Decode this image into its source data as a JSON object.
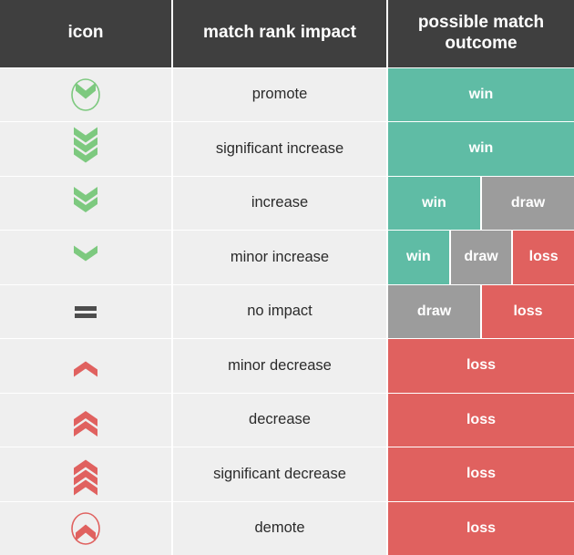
{
  "table": {
    "headers": {
      "icon": "icon",
      "impact": "match rank impact",
      "outcome": "possible match outcome"
    },
    "colors": {
      "header_bg": "#3f3f3f",
      "row_bg": "#efefef",
      "win": "#5fbca5",
      "draw": "#9c9c9c",
      "loss": "#e0615f",
      "up_icon": "#7dc97f",
      "down_icon": "#e0615f",
      "neutral_icon": "#4d4d4d",
      "text": "#2b2b2b",
      "header_text": "#ffffff"
    },
    "rows": [
      {
        "icon": "circled-chevron-up-icon",
        "impact": "promote",
        "outcomes": [
          {
            "label": "win",
            "type": "win",
            "weight": 3
          }
        ]
      },
      {
        "icon": "triple-chevron-up-icon",
        "impact": "significant increase",
        "outcomes": [
          {
            "label": "win",
            "type": "win",
            "weight": 3
          }
        ]
      },
      {
        "icon": "double-chevron-up-icon",
        "impact": "increase",
        "outcomes": [
          {
            "label": "win",
            "type": "win",
            "weight": 1.5
          },
          {
            "label": "draw",
            "type": "draw",
            "weight": 1.5
          }
        ]
      },
      {
        "icon": "single-chevron-up-icon",
        "impact": "minor increase",
        "outcomes": [
          {
            "label": "win",
            "type": "win",
            "weight": 1
          },
          {
            "label": "draw",
            "type": "draw",
            "weight": 1
          },
          {
            "label": "loss",
            "type": "loss",
            "weight": 1
          }
        ]
      },
      {
        "icon": "equals-icon",
        "impact": "no impact",
        "outcomes": [
          {
            "label": "draw",
            "type": "draw",
            "weight": 1.5
          },
          {
            "label": "loss",
            "type": "loss",
            "weight": 1.5
          }
        ]
      },
      {
        "icon": "single-chevron-down-icon",
        "impact": "minor decrease",
        "outcomes": [
          {
            "label": "loss",
            "type": "loss",
            "weight": 3
          }
        ]
      },
      {
        "icon": "double-chevron-down-icon",
        "impact": "decrease",
        "outcomes": [
          {
            "label": "loss",
            "type": "loss",
            "weight": 3
          }
        ]
      },
      {
        "icon": "triple-chevron-down-icon",
        "impact": "significant decrease",
        "outcomes": [
          {
            "label": "loss",
            "type": "loss",
            "weight": 3
          }
        ]
      },
      {
        "icon": "circled-chevron-down-icon",
        "impact": "demote",
        "outcomes": [
          {
            "label": "loss",
            "type": "loss",
            "weight": 3
          }
        ]
      }
    ]
  }
}
